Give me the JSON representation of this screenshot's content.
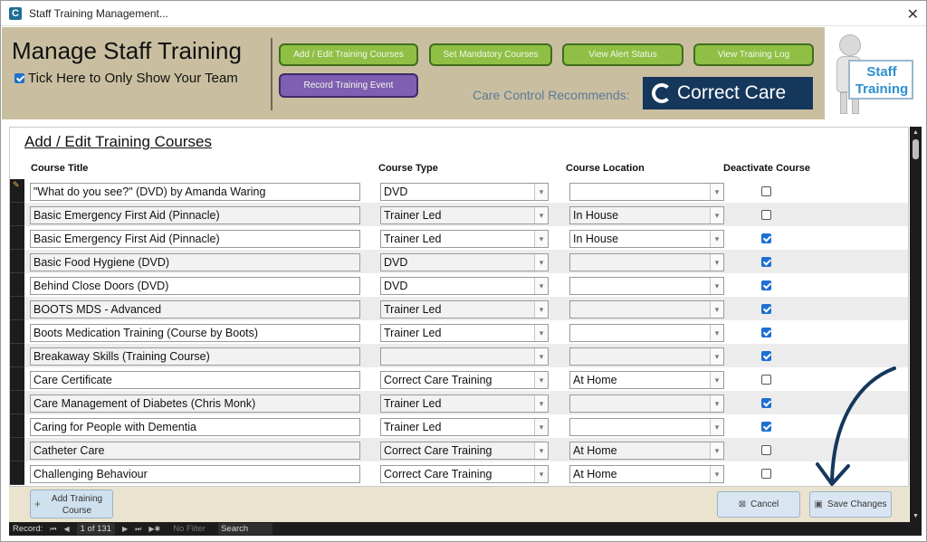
{
  "window": {
    "title": "Staff Training Management...",
    "close_glyph": "✕"
  },
  "header": {
    "title": "Manage Staff Training",
    "team_checkbox_label": "Tick Here to Only Show Your Team",
    "buttons": {
      "add_edit": "Add / Edit Training Courses",
      "set_mandatory": "Set Mandatory Courses",
      "view_alert": "View Alert Status",
      "view_log": "View Training Log",
      "record_event": "Record Training Event"
    },
    "recommends": "Care Control Recommends:",
    "logo_text": "Correct Care",
    "staff_sign": "Staff Training"
  },
  "section": {
    "title": "Add / Edit Training Courses",
    "columns": {
      "title": "Course Title",
      "type": "Course Type",
      "location": "Course Location",
      "deactivate": "Deactivate Course"
    }
  },
  "rows": [
    {
      "title": "\"What do you see?\" (DVD) by Amanda Waring",
      "type": "DVD",
      "location": "",
      "deactivated": false
    },
    {
      "title": "Basic Emergency First Aid (Pinnacle)",
      "type": "Trainer Led",
      "location": "In House",
      "deactivated": false
    },
    {
      "title": "Basic Emergency First Aid (Pinnacle)",
      "type": "Trainer Led",
      "location": "In House",
      "deactivated": true
    },
    {
      "title": "Basic Food Hygiene (DVD)",
      "type": "DVD",
      "location": "",
      "deactivated": true
    },
    {
      "title": "Behind Close Doors (DVD)",
      "type": "DVD",
      "location": "",
      "deactivated": true
    },
    {
      "title": "BOOTS MDS - Advanced",
      "type": "Trainer Led",
      "location": "",
      "deactivated": true
    },
    {
      "title": "Boots Medication Training (Course by Boots)",
      "type": "Trainer Led",
      "location": "",
      "deactivated": true
    },
    {
      "title": "Breakaway Skills (Training Course)",
      "type": "",
      "location": "",
      "deactivated": true
    },
    {
      "title": "Care Certificate",
      "type": "Correct Care Training",
      "location": "At Home",
      "deactivated": false
    },
    {
      "title": "Care Management of Diabetes (Chris Monk)",
      "type": "Trainer Led",
      "location": "",
      "deactivated": true
    },
    {
      "title": "Caring for People with Dementia",
      "type": "Trainer Led",
      "location": "",
      "deactivated": true
    },
    {
      "title": "Catheter Care",
      "type": "Correct Care Training",
      "location": "At Home",
      "deactivated": false
    },
    {
      "title": "Challenging Behaviour",
      "type": "Correct Care Training",
      "location": "At Home",
      "deactivated": false
    }
  ],
  "footer": {
    "add_course": "Add Training Course",
    "cancel": "Cancel",
    "save": "Save Changes"
  },
  "nav": {
    "record_label": "Record:",
    "position": "1 of 131",
    "filter": "No Filter",
    "search": "Search"
  },
  "colors": {
    "header_bg": "#c9bfa0",
    "green_button": "#8fbf45",
    "purple_button": "#7f5fb1",
    "logo_bg": "#16375c",
    "checkbox_blue": "#1e6fd1"
  }
}
